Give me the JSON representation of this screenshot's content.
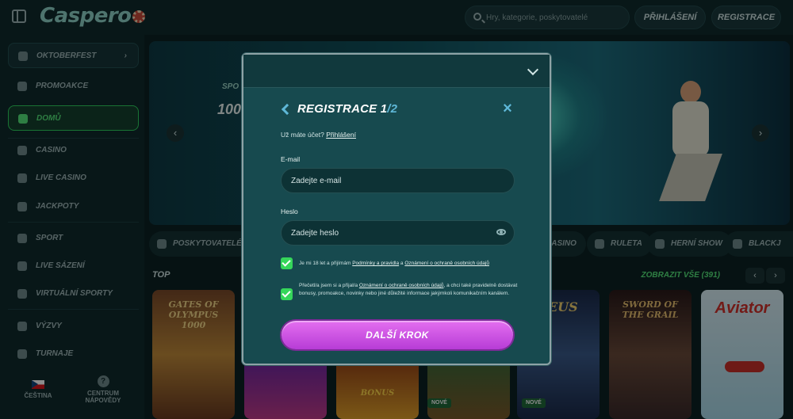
{
  "header": {
    "logo": "Caspero",
    "search_placeholder": "Hry, kategorie, poskytovatelé",
    "login": "PŘIHLÁŠENÍ",
    "register": "REGISTRACE"
  },
  "sidebar": {
    "items": [
      {
        "label": "OKTOBERFEST",
        "icon": "beer-icon"
      },
      {
        "label": "PROMOAKCE",
        "icon": "gift-icon"
      },
      {
        "label": "DOMŮ",
        "icon": "home-icon"
      },
      {
        "label": "CASINO",
        "icon": "casino-icon"
      },
      {
        "label": "LIVE CASINO",
        "icon": "live-casino-icon"
      },
      {
        "label": "JACKPOTY",
        "icon": "jackpot-icon"
      },
      {
        "label": "SPORT",
        "icon": "sport-icon"
      },
      {
        "label": "LIVE SÁZENÍ",
        "icon": "live-bet-icon"
      },
      {
        "label": "VIRTUÁLNÍ SPORTY",
        "icon": "virtual-sport-icon"
      },
      {
        "label": "VÝZVY",
        "icon": "challenge-icon"
      },
      {
        "label": "TURNAJE",
        "icon": "trophy-icon"
      }
    ],
    "language": "ČEŠTINA",
    "help": "CENTRUM NÁPOVĚDY"
  },
  "banner": {
    "promo_small": "SPO",
    "promo_big": "100"
  },
  "categories": [
    "POSKYTOVATELÉ",
    "CASINO",
    "RULETA",
    "HERNÍ SHOW",
    "BLACKJ"
  ],
  "games_section": {
    "title": "TOP",
    "show_all": "ZOBRAZIT VŠE (391)",
    "tiles": [
      {
        "title": "GATES OF OLYMPUS 1000",
        "new": ""
      },
      {
        "title": "",
        "new": ""
      },
      {
        "title": "BONUS",
        "new": ""
      },
      {
        "title": "",
        "new": "NOVÉ"
      },
      {
        "title": "ZEUS",
        "new": "NOVÉ"
      },
      {
        "title": "SWORD OF THE GRAIL",
        "new": ""
      },
      {
        "title": "Aviator",
        "new": ""
      }
    ]
  },
  "modal": {
    "title": "REGISTRACE 1",
    "step": "/2",
    "have_account": "Už máte účet?",
    "login_link": "Přihlášení",
    "email_label": "E-mail",
    "email_placeholder": "Zadejte e-mail",
    "password_label": "Heslo",
    "password_placeholder": "Zadejte heslo",
    "terms_text_1": "Je mi 18 let a přijímám",
    "terms_link_1": "Podmínky a pravidla",
    "terms_and": "a",
    "terms_link_2": "Oznámení o ochraně osobních údajů",
    "marketing_text_1": "Přečetl/a jsem si a přijal/a",
    "marketing_link": "Oznámení o ochraně osobních údajů",
    "marketing_text_2": ", a chci také pravidelně dostávat bonusy, promoakce, novinky nebo jiné důležité informace jakýmkoli komunikačním kanálem.",
    "next_button": "DALŠÍ KROK"
  },
  "colors": {
    "accent_green": "#55e67a",
    "cta_purple": "#c44fe0",
    "step_blue": "#5fb8d8"
  }
}
